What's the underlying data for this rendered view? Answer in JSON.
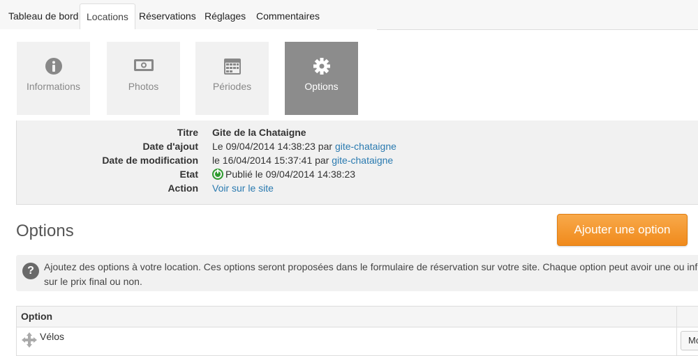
{
  "nav": {
    "tabs": [
      {
        "label": "Tableau de bord"
      },
      {
        "label": "Locations"
      },
      {
        "label": "Réservations"
      },
      {
        "label": "Réglages"
      },
      {
        "label": "Commentaires"
      }
    ],
    "active": "Locations"
  },
  "tiles": [
    {
      "label": "Informations",
      "icon": "info-icon"
    },
    {
      "label": "Photos",
      "icon": "camera-icon"
    },
    {
      "label": "Périodes",
      "icon": "calendar-icon"
    },
    {
      "label": "Options",
      "icon": "gear-icon"
    }
  ],
  "info": {
    "titre_label": "Titre",
    "titre_value": "Gite de la Chataigne",
    "ajout_label": "Date d'ajout",
    "ajout_text": "Le 09/04/2014 14:38:23 par ",
    "ajout_user": "gite-chataigne",
    "modif_label": "Date de modification",
    "modif_text": "le 16/04/2014 15:37:41 par ",
    "modif_user": "gite-chataigne",
    "etat_label": "Etat",
    "etat_text": "Publié le 09/04/2014 14:38:23",
    "action_label": "Action",
    "action_link": "Voir sur le site"
  },
  "options": {
    "title": "Options",
    "add_button": "Ajouter une option",
    "help": "Ajoutez des options à votre location. Ces options seront proposées dans le formulaire de réservation sur votre site. Chaque option peut avoir une ou influer sur le prix final ou non.",
    "table_header": "Option",
    "rows": [
      {
        "name": "Vélos",
        "button": "Mo"
      }
    ]
  },
  "colors": {
    "accent": "#f08a1c",
    "link": "#2a7ab0",
    "status_green": "#2e9b2e",
    "tile_active": "#8c8c8c"
  }
}
